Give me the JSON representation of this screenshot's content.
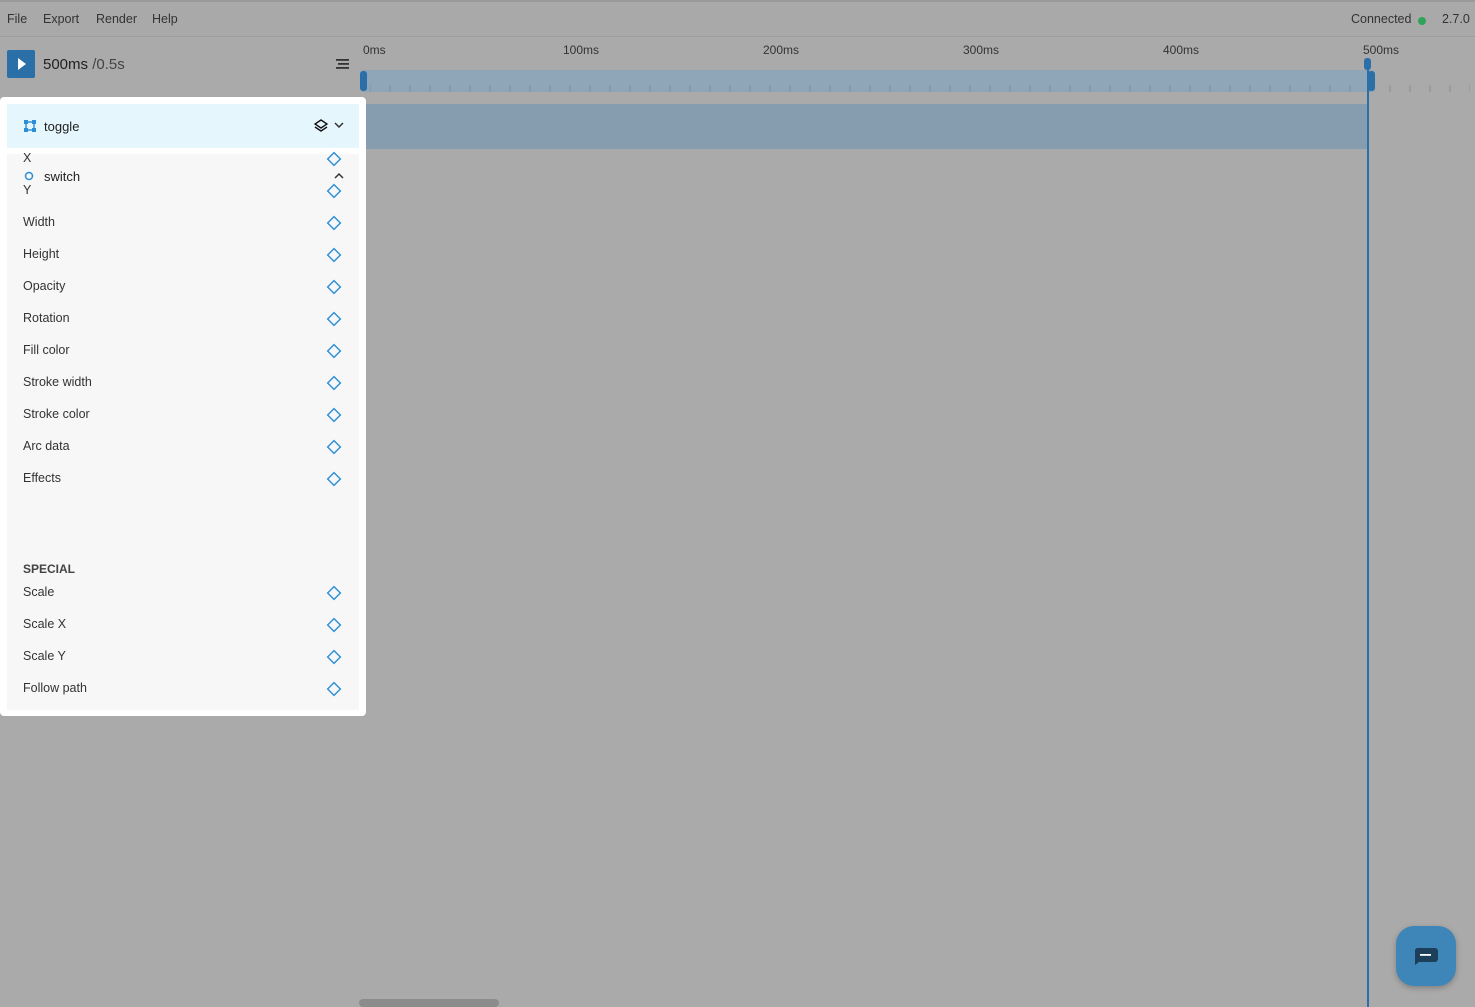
{
  "menu": {
    "items": [
      {
        "label": "File"
      },
      {
        "label": "Export"
      },
      {
        "label": "Render"
      },
      {
        "label": "Help"
      }
    ],
    "status": "Connected",
    "version": "2.7.0",
    "status_color": "#2fa35a"
  },
  "playback": {
    "current": "500ms",
    "total": "/0.5s"
  },
  "timeline": {
    "ticks": [
      "0ms",
      "100ms",
      "200ms",
      "300ms",
      "400ms",
      "500ms"
    ],
    "accent_color": "#2b6fa8"
  },
  "layer": {
    "name": "toggle",
    "shape": "switch"
  },
  "properties": [
    {
      "label": "X"
    },
    {
      "label": "Y"
    },
    {
      "label": "Width"
    },
    {
      "label": "Height"
    },
    {
      "label": "Opacity"
    },
    {
      "label": "Rotation"
    },
    {
      "label": "Fill color"
    },
    {
      "label": "Stroke width"
    },
    {
      "label": "Stroke color"
    },
    {
      "label": "Arc data"
    },
    {
      "label": "Effects"
    }
  ],
  "special": {
    "title": "SPECIAL",
    "properties": [
      {
        "label": "Scale"
      },
      {
        "label": "Scale X"
      },
      {
        "label": "Scale Y"
      },
      {
        "label": "Follow path"
      }
    ]
  },
  "icons": {
    "play": "play-icon",
    "list": "list-icon",
    "frame": "frame-icon",
    "circle": "circle-icon",
    "layers": "layers-icon",
    "chevron_down": "chevron-down-icon",
    "chevron_up": "chevron-up-icon",
    "keyframe": "keyframe-diamond-icon",
    "chat": "chat-icon"
  }
}
